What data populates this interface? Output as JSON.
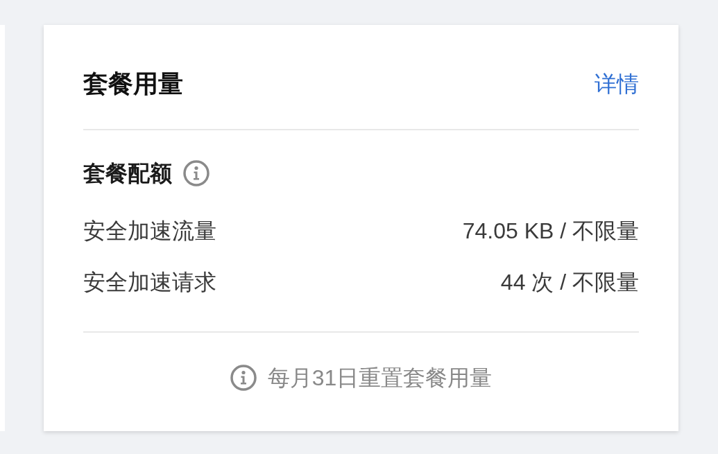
{
  "panel": {
    "title": "套餐用量",
    "detail_link": "详情",
    "quota_section": {
      "title": "套餐配额",
      "items": [
        {
          "label": "安全加速流量",
          "value": "74.05 KB / 不限量"
        },
        {
          "label": "安全加速请求",
          "value": "44 次 / 不限量"
        }
      ]
    },
    "footer_note": "每月31日重置套餐用量"
  }
}
